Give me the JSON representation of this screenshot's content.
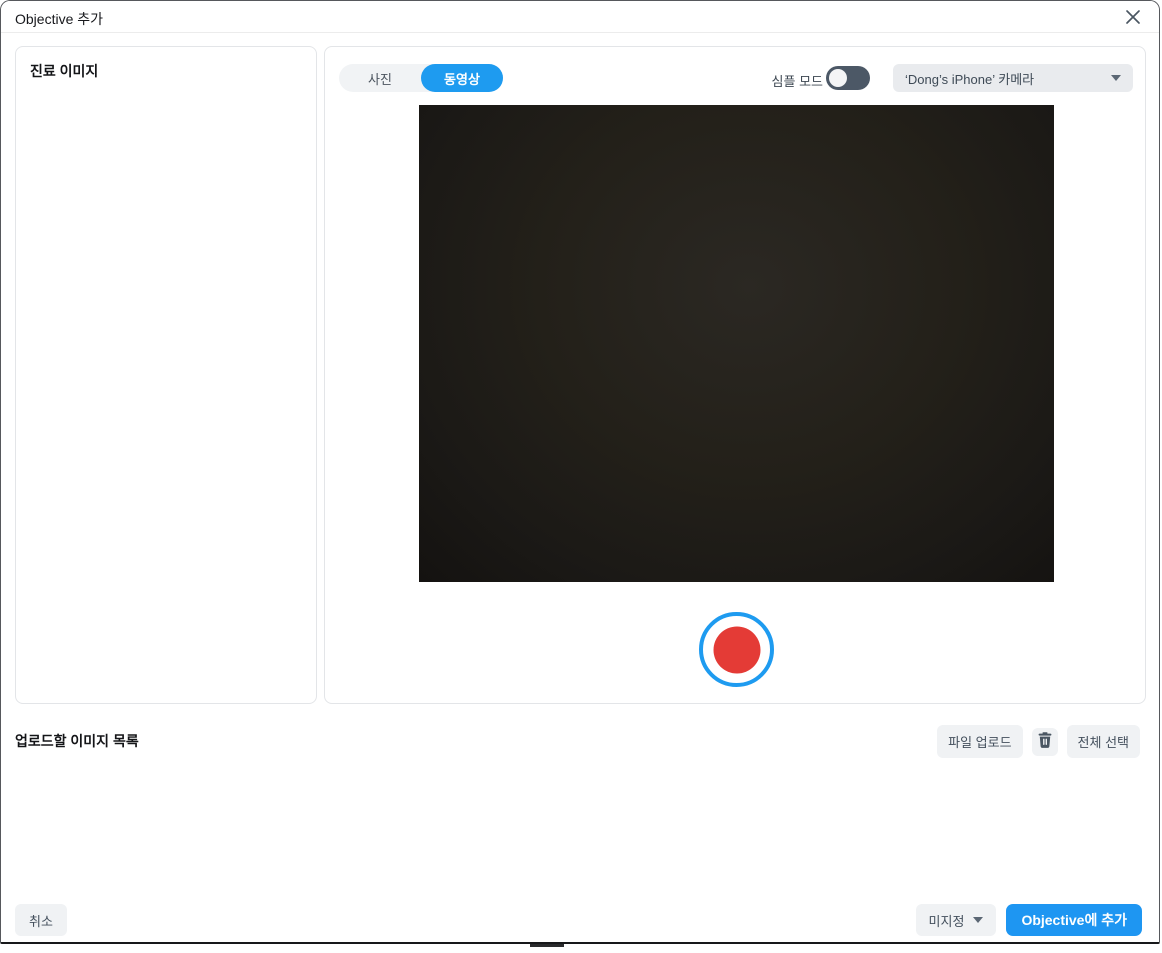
{
  "modal": {
    "title": "Objective 추가"
  },
  "left_panel": {
    "title": "진료 이미지"
  },
  "capture_panel": {
    "tabs": [
      {
        "label": "사진",
        "active": false
      },
      {
        "label": "동영상",
        "active": true
      }
    ],
    "simple_mode_label": "심플 모드",
    "simple_mode_on": false,
    "camera_select_value": "‘Dong’s iPhone’ 카메라"
  },
  "upload_section": {
    "title": "업로드할 이미지 목록",
    "file_upload_label": "파일 업로드",
    "select_all_label": "전체 선택"
  },
  "footer": {
    "cancel_label": "취소",
    "category_label": "미지정",
    "submit_label": "Objective에 추가"
  },
  "colors": {
    "accent_blue": "#1e9bf0",
    "record_red": "#e43b36",
    "toggle_track": "#4c5866",
    "button_gray": "#f0f2f4",
    "slate_text": "#434f5c"
  }
}
